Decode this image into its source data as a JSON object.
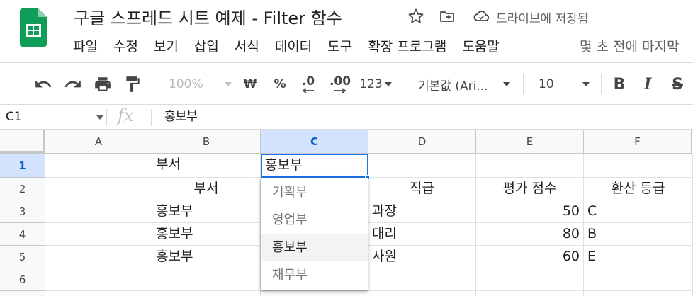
{
  "header": {
    "title": "구글 스프레드 시트 예제 - Filter 함수",
    "save_status": "드라이브에 저장됨",
    "last_edit": "몇 초 전에 마지막",
    "menus": [
      "파일",
      "수정",
      "보기",
      "삽입",
      "서식",
      "데이터",
      "도구",
      "확장 프로그램",
      "도움말"
    ],
    "icons": [
      "star-icon",
      "move-folder-icon",
      "cloud-saved-icon"
    ]
  },
  "toolbar": {
    "zoom": "100%",
    "currency": "₩",
    "percent": "%",
    "decrease_decimal": ".0",
    "increase_decimal": ".00",
    "more_formats": "123",
    "font": "기본값 (Ari...",
    "font_size": "10",
    "bold": "B",
    "italic": "I",
    "strikethrough": "S"
  },
  "formula_bar": {
    "cell_ref": "C1",
    "fx": "fx",
    "value": "홍보부"
  },
  "grid": {
    "columns": [
      "A",
      "B",
      "C",
      "D",
      "E",
      "F"
    ],
    "active_column": "C",
    "rows": [
      "1",
      "2",
      "3",
      "4",
      "5",
      "6"
    ],
    "active_row": "1",
    "cells": {
      "B1": "부서",
      "C1": "홍보부",
      "B2": "부서",
      "D2": "직급",
      "E2": "평가 점수",
      "F2": "환산 등급",
      "B3": "홍보부",
      "D3": "과장",
      "E3": "50",
      "F3": "C",
      "B4": "홍보부",
      "D4": "대리",
      "E4": "80",
      "F4": "B",
      "B5": "홍보부",
      "D5": "사원",
      "E5": "60",
      "F5": "E"
    }
  },
  "dropdown": {
    "options": [
      "기획부",
      "영업부",
      "홍보부",
      "재무부"
    ],
    "highlighted": "홍보부"
  },
  "colors": {
    "accent": "#1a73e8",
    "sheets_green": "#0f9d58",
    "header_bg": "#f8f9fa",
    "active_header_bg": "#d3e3fd"
  }
}
